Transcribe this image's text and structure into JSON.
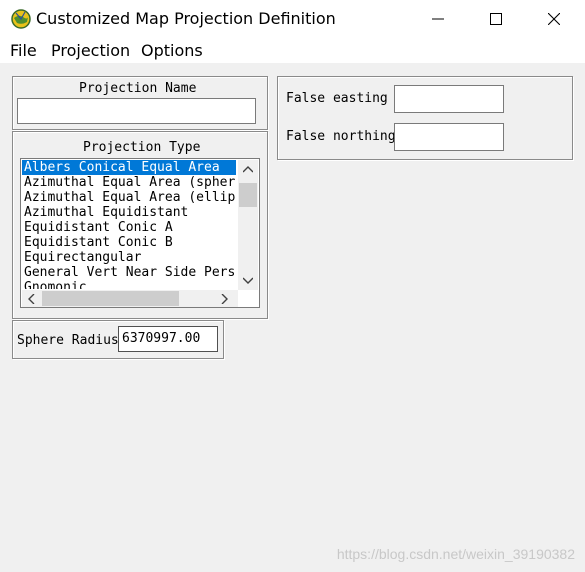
{
  "window": {
    "title": "Customized Map Projection Definition"
  },
  "menu": {
    "file": "File",
    "projection": "Projection",
    "options": "Options"
  },
  "projection_name": {
    "label": "Projection Name",
    "value": ""
  },
  "projection_type": {
    "label": "Projection Type",
    "items": [
      "Albers Conical Equal Area",
      "Azimuthal Equal Area (sphere",
      "Azimuthal Equal Area (ellips",
      "Azimuthal Equidistant",
      "Equidistant Conic A",
      "Equidistant Conic B",
      "Equirectangular",
      "General Vert Near Side Persp",
      "Gnomonic"
    ],
    "selected_index": 0
  },
  "sphere_radius": {
    "label": "Sphere Radius",
    "value": "6370997.00"
  },
  "false_easting": {
    "label": "False easting",
    "value": ""
  },
  "false_northing": {
    "label": "False northing",
    "value": ""
  },
  "watermark": "https://blog.csdn.net/weixin_39190382",
  "colors": {
    "selection": "#0078d7",
    "window_bg": "#f0f0f0"
  }
}
